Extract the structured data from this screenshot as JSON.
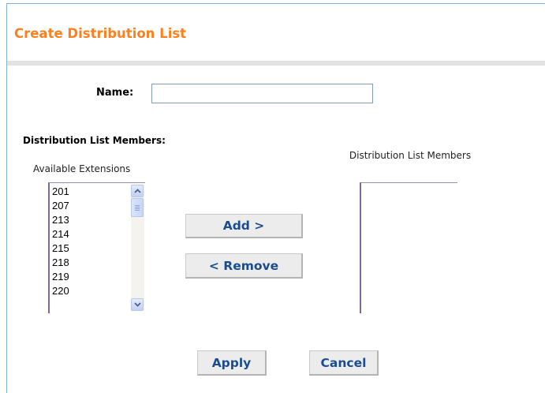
{
  "header": {
    "title": "Create Distribution List"
  },
  "form": {
    "name_label": "Name:",
    "name_value": "",
    "members_heading": "Distribution List Members:",
    "available_label": "Available Extensions",
    "members_label": "Distribution List Members",
    "available_extensions": [
      "201",
      "207",
      "213",
      "214",
      "215",
      "218",
      "219",
      "220"
    ],
    "members": []
  },
  "buttons": {
    "add": "Add >",
    "remove": "< Remove",
    "apply": "Apply",
    "cancel": "Cancel"
  },
  "colors": {
    "title": "#ff7f1f",
    "button_text": "#1a4d8f",
    "panel_border": "#7fb2de"
  },
  "icons": {
    "scroll_up": "chevron-up-icon",
    "scroll_down": "chevron-down-icon"
  }
}
